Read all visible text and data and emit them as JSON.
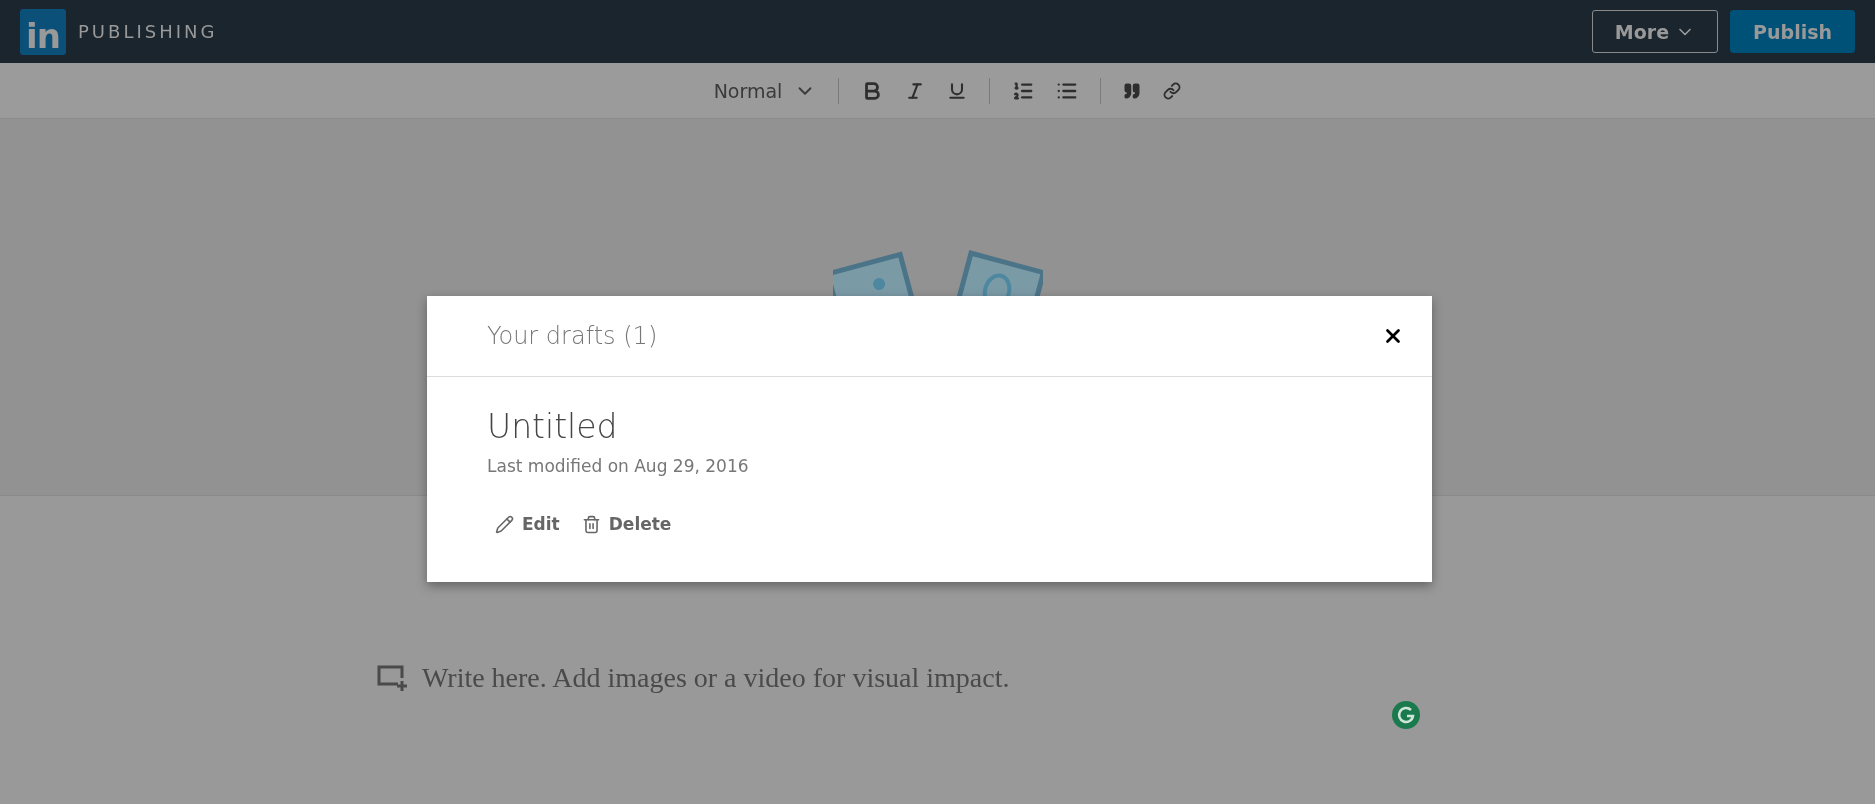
{
  "header": {
    "logo": "in",
    "brand": "PUBLISHING",
    "buttons": [
      {
        "label": "More",
        "kind": "dropdown"
      },
      {
        "label": "Publish",
        "kind": "primary"
      }
    ]
  },
  "toolbar": {
    "style_select": "Normal"
  },
  "editor": {
    "body_placeholder": "Write here. Add images or a video for visual impact."
  },
  "dialog": {
    "title": "Your drafts (1)",
    "drafts": [
      {
        "title": "Untitled",
        "modified": "Last modified on Aug 29, 2016",
        "actions": [
          {
            "label": "Edit",
            "kind": "edit"
          },
          {
            "label": "Delete",
            "kind": "delete"
          }
        ]
      }
    ]
  }
}
